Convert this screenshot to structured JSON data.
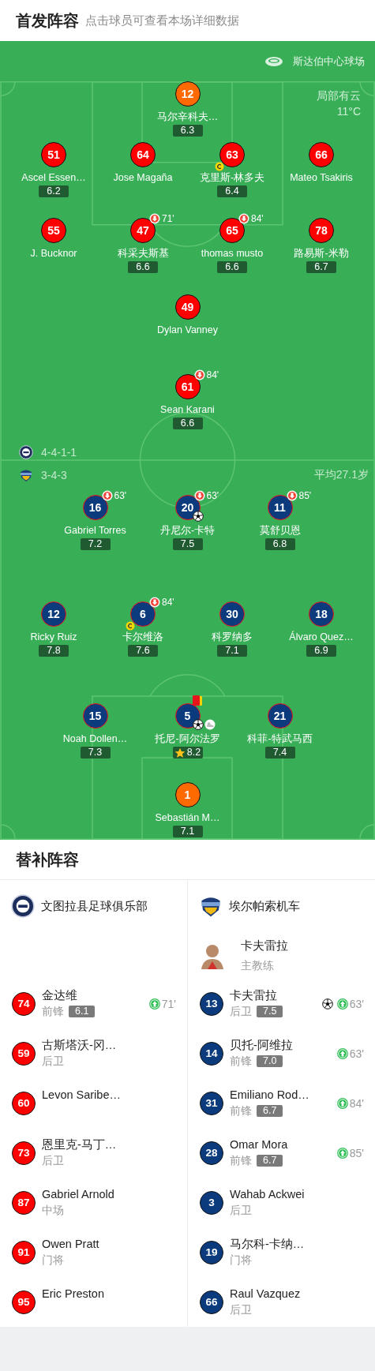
{
  "header": {
    "title": "首发阵容",
    "subtitle": "点击球员可查看本场详细数据"
  },
  "pitch": {
    "stadium": "斯达伯中心球场",
    "weather": "局部有云",
    "temperature": "11°C"
  },
  "lineups": [
    {
      "formation": "4-4-1-1",
      "color": "#ff0000",
      "lines": [
        [
          {
            "number": "12",
            "name": "马尔辛科夫…",
            "kind": "goalkeeper",
            "rating": "6.3",
            "captain": false,
            "goal": false
          }
        ],
        [
          {
            "number": "51",
            "name": "Ascel Essen…",
            "kind": "outfield",
            "rating": "6.2",
            "captain": false,
            "goal": false
          },
          {
            "number": "64",
            "name": "Jose Magaña",
            "kind": "outfield",
            "captain": false,
            "goal": false
          },
          {
            "number": "63",
            "name": "克里斯-林多夫",
            "kind": "outfield",
            "rating": "6.4",
            "captain": true,
            "goal": false
          },
          {
            "number": "66",
            "name": "Mateo Tsakiris",
            "kind": "outfield",
            "captain": false,
            "goal": false
          }
        ],
        [
          {
            "number": "55",
            "name": "J. Bucknor",
            "kind": "outfield",
            "captain": false,
            "goal": false
          },
          {
            "number": "47",
            "name": "科采夫斯基",
            "kind": "outfield",
            "rating": "6.6",
            "sub_off": "71'",
            "captain": false,
            "goal": false
          },
          {
            "number": "65",
            "name": "thomas musto",
            "kind": "outfield",
            "rating": "6.6",
            "sub_off": "84'",
            "captain": false,
            "goal": false
          },
          {
            "number": "78",
            "name": "路易斯-米勒",
            "kind": "outfield",
            "rating": "6.7",
            "captain": false,
            "goal": false
          }
        ],
        [
          {
            "number": "49",
            "name": "Dylan Vanney",
            "kind": "outfield",
            "captain": false,
            "goal": false
          }
        ],
        [
          {
            "number": "61",
            "name": "Sean Karani",
            "kind": "outfield",
            "rating": "6.6",
            "sub_off": "84'",
            "captain": false,
            "goal": false
          }
        ]
      ]
    },
    {
      "formation": "3-4-3",
      "average_age": "平均27.1岁",
      "color": "#0b3b7d",
      "lines": [
        [
          {
            "number": "16",
            "name": "Gabriel Torres",
            "kind": "outfield",
            "rating": "7.2",
            "sub_off": "63'",
            "captain": false,
            "goal": false
          },
          {
            "number": "20",
            "name": "丹尼尔-卡特",
            "kind": "outfield",
            "rating": "7.5",
            "sub_off": "63'",
            "captain": false,
            "goal": true
          },
          {
            "number": "11",
            "name": "莫舒贝恩",
            "kind": "outfield",
            "rating": "6.8",
            "sub_off": "85'",
            "captain": false,
            "goal": false
          }
        ],
        [
          {
            "number": "12",
            "name": "Ricky Ruiz",
            "kind": "outfield",
            "rating": "7.8",
            "captain": false,
            "goal": false
          },
          {
            "number": "6",
            "name": "卡尔维洛",
            "kind": "outfield",
            "rating": "7.6",
            "sub_off": "84'",
            "captain": true,
            "goal": false
          },
          {
            "number": "30",
            "name": "科罗纳多",
            "kind": "outfield",
            "rating": "7.1",
            "captain": false,
            "goal": false
          },
          {
            "number": "18",
            "name": "Álvaro Quez…",
            "kind": "outfield",
            "rating": "6.9",
            "captain": false,
            "goal": false
          }
        ],
        [
          {
            "number": "15",
            "name": "Noah Dollen…",
            "kind": "outfield",
            "rating": "7.3",
            "captain": false,
            "goal": false
          },
          {
            "number": "5",
            "name": "托尼-阿尔法罗",
            "kind": "outfield",
            "rating": "8.2",
            "captain": false,
            "goal": true,
            "sent_off": true,
            "assist": true,
            "best": true
          },
          {
            "number": "21",
            "name": "科菲-特武马西",
            "kind": "outfield",
            "rating": "7.4",
            "captain": false,
            "goal": false
          }
        ],
        [
          {
            "number": "1",
            "name": "Sebastián M…",
            "kind": "goalkeeper",
            "rating": "7.1",
            "captain": false,
            "goal": false
          }
        ]
      ]
    }
  ],
  "bench_title": "替补阵容",
  "bench": [
    {
      "team": "文图拉县足球俱乐部",
      "players": [
        {
          "number": "74",
          "name": "金达维",
          "position": "前锋",
          "rating": "6.1",
          "sub_on": "71'",
          "goal": false
        },
        {
          "number": "59",
          "name": "古斯塔沃-冈…",
          "position": "后卫",
          "goal": false
        },
        {
          "number": "60",
          "name": "Levon Saribe…",
          "goal": false
        },
        {
          "number": "73",
          "name": "恩里克-马丁…",
          "position": "后卫",
          "goal": false
        },
        {
          "number": "87",
          "name": "Gabriel Arnold",
          "position": "中场",
          "goal": false
        },
        {
          "number": "91",
          "name": "Owen Pratt",
          "position": "门将",
          "goal": false
        },
        {
          "number": "95",
          "name": "Eric Preston",
          "goal": false
        }
      ]
    },
    {
      "team": "埃尔帕索机车",
      "coach": {
        "name": "卡夫雷拉",
        "role": "主教练"
      },
      "players": [
        {
          "number": "13",
          "name": "卡夫雷拉",
          "position": "后卫",
          "rating": "7.5",
          "sub_on": "63'",
          "goal": true
        },
        {
          "number": "14",
          "name": "贝托-阿维拉",
          "position": "前锋",
          "rating": "7.0",
          "sub_on": "63'",
          "goal": false
        },
        {
          "number": "31",
          "name": "Emiliano Rod…",
          "position": "前锋",
          "rating": "6.7",
          "sub_on": "84'",
          "goal": false
        },
        {
          "number": "28",
          "name": "Omar Mora",
          "position": "前锋",
          "rating": "6.7",
          "sub_on": "85'",
          "goal": false
        },
        {
          "number": "3",
          "name": "Wahab Ackwei",
          "position": "后卫",
          "goal": false
        },
        {
          "number": "19",
          "name": "马尔科-卡纳…",
          "position": "门将",
          "goal": false
        },
        {
          "number": "66",
          "name": "Raul Vazquez",
          "position": "后卫",
          "goal": false
        }
      ]
    }
  ]
}
